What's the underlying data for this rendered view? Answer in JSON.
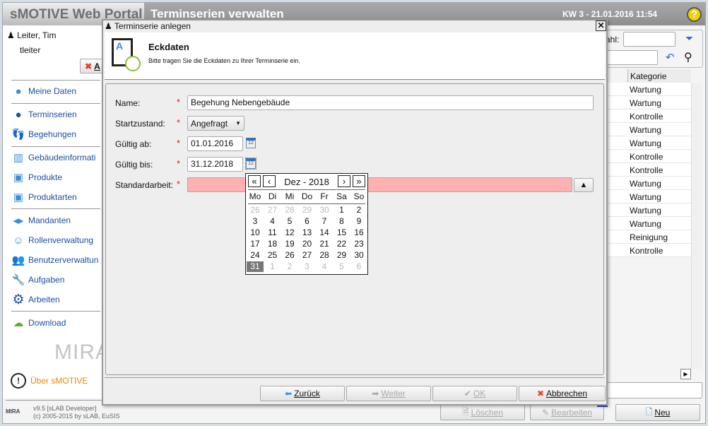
{
  "header": {
    "brand": "sMOTIVE Web Portal",
    "title": "Terminserien verwalten",
    "datetime": "KW 3 - 21.01.2016 11:54",
    "help": "?"
  },
  "user": {
    "name": "Leiter, Tim",
    "login": "tleiter",
    "logout_label": "A"
  },
  "sidebar": {
    "items": [
      {
        "label": "Meine Daten",
        "icon": "user-icon"
      },
      {
        "label": "Terminserien",
        "icon": "recurring-user-icon"
      },
      {
        "label": "Begehungen",
        "icon": "footprints-icon"
      },
      {
        "label": "Gebäudeinformati",
        "icon": "building-icon"
      },
      {
        "label": "Produkte",
        "icon": "product-icon"
      },
      {
        "label": "Produktarten",
        "icon": "product-type-icon"
      },
      {
        "label": "Mandanten",
        "icon": "tenants-icon"
      },
      {
        "label": "Rollenverwaltung",
        "icon": "masks-icon"
      },
      {
        "label": "Benutzerverwaltun",
        "icon": "users-icon"
      },
      {
        "label": "Aufgaben",
        "icon": "wrench-icon"
      },
      {
        "label": "Arbeiten",
        "icon": "gear-icon"
      },
      {
        "label": "Download",
        "icon": "cloud-download-icon"
      }
    ],
    "logo": "MIRA",
    "about": "Über sMOTIVE",
    "version": "v9.5 [sLAB Developer]",
    "copyright": "(c) 2005-2015 by sLAB, EuSIS"
  },
  "filter": {
    "label": "ahl:",
    "value": "",
    "search_value": ""
  },
  "table": {
    "header": "Kategorie",
    "rows": [
      "Wartung",
      "Wartung",
      "Kontrolle",
      "Wartung",
      "Wartung",
      "Kontrolle",
      "Kontrolle",
      "Wartung",
      "Wartung",
      "Wartung",
      "Wartung",
      "Reinigung",
      "Kontrolle"
    ]
  },
  "bottom": {
    "delete": "Löschen",
    "edit": "Bearbeiten",
    "new": "Neu"
  },
  "dialog": {
    "title": "Terminserie anlegen",
    "heading": "Eckdaten",
    "subtitle": "Bitte tragen Sie die Eckdaten zu Ihrer Terminserie ein.",
    "fields": {
      "name_label": "Name:",
      "name_value": "Begehung Nebengebäude",
      "state_label": "Startzustand:",
      "state_value": "Angefragt",
      "from_label": "Gültig ab:",
      "from_value": "01.01.2016",
      "to_label": "Gültig bis:",
      "to_value": "31.12.2018",
      "work_label": "Standardarbeit:",
      "work_value": "",
      "required": "*"
    },
    "buttons": {
      "back": "Zurück",
      "next": "Weiter",
      "ok": "OK",
      "cancel": "Abbrechen"
    }
  },
  "calendar": {
    "month": "Dez - 2018",
    "weekdays": [
      "Mo",
      "Di",
      "Mi",
      "Do",
      "Fr",
      "Sa",
      "So"
    ],
    "weeks": [
      [
        "26",
        "27",
        "28",
        "29",
        "30",
        "1",
        "2"
      ],
      [
        "3",
        "4",
        "5",
        "6",
        "7",
        "8",
        "9"
      ],
      [
        "10",
        "11",
        "12",
        "13",
        "14",
        "15",
        "16"
      ],
      [
        "17",
        "18",
        "19",
        "20",
        "21",
        "22",
        "23"
      ],
      [
        "24",
        "25",
        "26",
        "27",
        "28",
        "29",
        "30"
      ],
      [
        "31",
        "1",
        "2",
        "3",
        "4",
        "5",
        "6"
      ]
    ],
    "selected": "31"
  },
  "colors": {
    "link": "#1c4ea0",
    "required": "#e02020",
    "invalid_field": "#ffb0b0",
    "about": "#e88a00"
  }
}
